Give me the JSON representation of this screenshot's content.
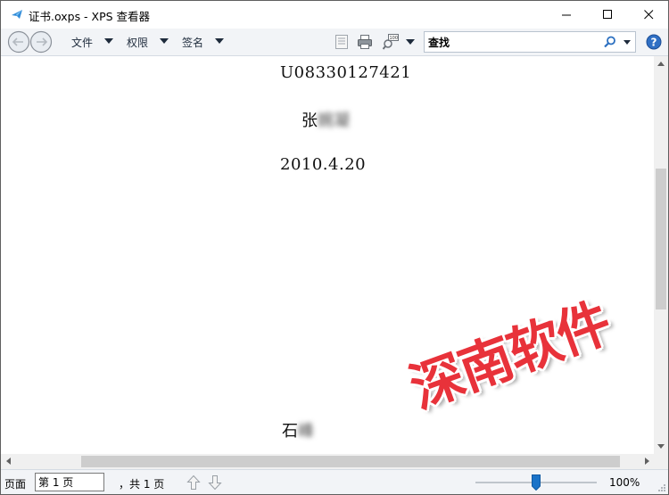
{
  "window": {
    "title": "证书.oxps - XPS 查看器"
  },
  "toolbar": {
    "menus": [
      "文件",
      "权限",
      "签名"
    ],
    "search_value": "查找",
    "icons": [
      "back-forward-icon",
      "page-view-icon",
      "print-icon",
      "zoom-icon",
      "search-icon",
      "help-icon"
    ]
  },
  "document": {
    "certificate_number": "U08330127421",
    "holder_surname": "张",
    "holder_given_blurred": "婉凝",
    "date": "2010.4.20",
    "signer_surname": "石",
    "signer_given_blurred": "峰"
  },
  "watermark": {
    "text": "深南软件",
    "color": "#e8323a"
  },
  "statusbar": {
    "page_label": "页面",
    "page_input": "第 1 页",
    "page_total": "，共 1 页",
    "zoom": "100%"
  },
  "colors": {
    "accent": "#1a73c8",
    "toolbar_bg": "#f2f4f7"
  }
}
